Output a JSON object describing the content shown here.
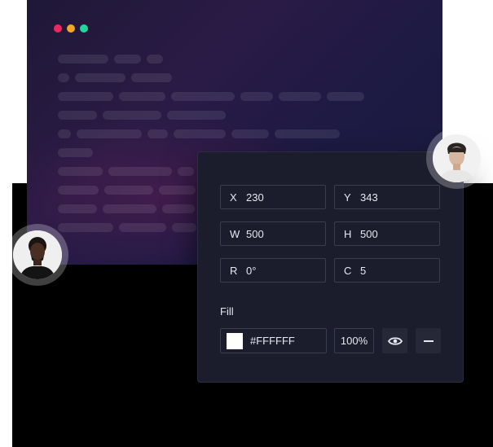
{
  "window": {
    "controls": [
      "close",
      "minimize",
      "maximize"
    ],
    "control_colors": [
      "#f0275e",
      "#f5a623",
      "#1fd99c"
    ]
  },
  "properties": {
    "x": {
      "label": "X",
      "value": "230"
    },
    "y": {
      "label": "Y",
      "value": "343"
    },
    "w": {
      "label": "W",
      "value": "500"
    },
    "h": {
      "label": "H",
      "value": "500"
    },
    "r": {
      "label": "R",
      "value": "0°"
    },
    "c": {
      "label": "C",
      "value": "5"
    }
  },
  "fill": {
    "title": "Fill",
    "color_hex": "#FFFFFF",
    "opacity": "100%",
    "visibility_icon": "eye-icon",
    "remove_icon": "minus-icon"
  },
  "avatars": [
    "avatar-top-right",
    "avatar-left"
  ]
}
